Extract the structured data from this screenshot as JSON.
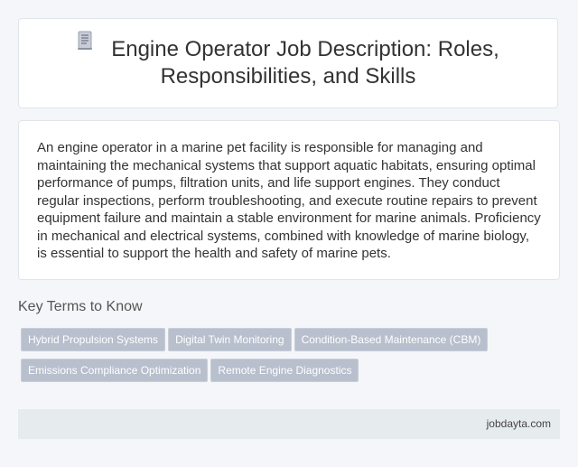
{
  "header": {
    "icon": "document-icon",
    "title": "Engine Operator Job Description: Roles, Responsibilities, and Skills"
  },
  "description": "An engine operator in a marine pet facility is responsible for managing and maintaining the mechanical systems that support aquatic habitats, ensuring optimal performance of pumps, filtration units, and life support engines. They conduct regular inspections, perform troubleshooting, and execute routine repairs to prevent equipment failure and maintain a stable environment for marine animals. Proficiency in mechanical and electrical systems, combined with knowledge of marine biology, is essential to support the health and safety of marine pets.",
  "key_terms": {
    "heading": "Key Terms to Know",
    "items": [
      "Hybrid Propulsion Systems",
      "Digital Twin Monitoring",
      "Condition-Based Maintenance (CBM)",
      "Emissions Compliance Optimization",
      "Remote Engine Diagnostics"
    ]
  },
  "footer": {
    "site": "jobdayta.com"
  },
  "colors": {
    "chip_bg": "#b8bfcd",
    "footer_bg": "#e6ebee",
    "page_bg": "#f4f6f9"
  }
}
